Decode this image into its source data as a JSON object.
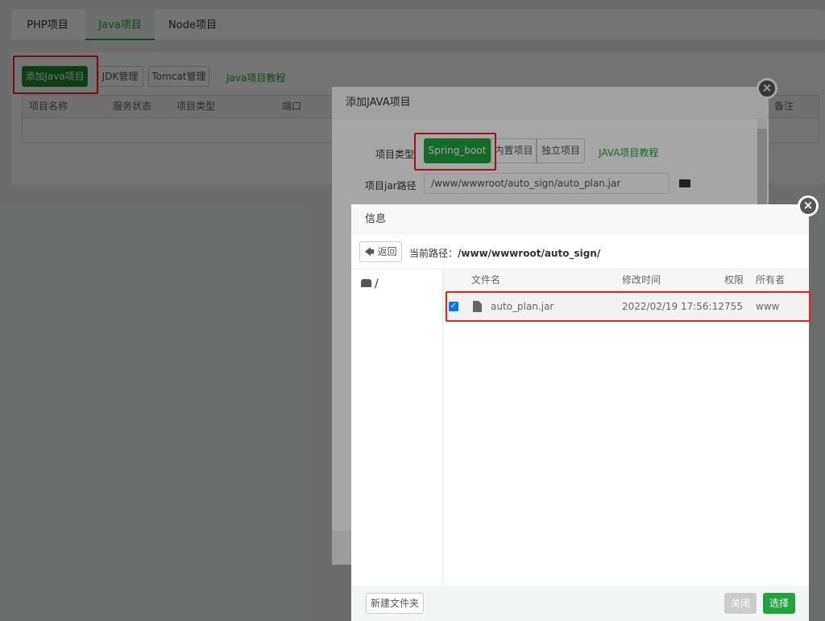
{
  "tabs": [
    {
      "label": "PHP项目"
    },
    {
      "label": "Java项目",
      "active": true
    },
    {
      "label": "Node项目"
    }
  ],
  "toolbar": {
    "add": "添加Java项目",
    "jdk": "JDK管理",
    "tomcat": "Tomcat管理",
    "tutorial": "Java项目教程"
  },
  "table": {
    "headers": [
      "项目名称",
      "服务状态",
      "项目类型",
      "端口",
      "备注"
    ]
  },
  "add_dialog": {
    "title": "添加JAVA项目",
    "type_label": "项目类型",
    "types": [
      "Spring_boot",
      "内置项目",
      "独立项目"
    ],
    "selected_type": "Spring_boot",
    "tutorial": "JAVA项目教程",
    "jar_label": "项目jar路径",
    "jar_value": "/www/wwwroot/auto_sign/auto_plan.jar",
    "folder_icon": "folder-open-icon"
  },
  "file_dialog": {
    "title": "信息",
    "back": "返回",
    "path_label": "当前路径：",
    "path": "/www/wwwroot/auto_sign/",
    "tree_root": "/",
    "headers": [
      "文件名",
      "修改时间",
      "权限",
      "所有者"
    ],
    "files": [
      {
        "name": "auto_plan.jar",
        "modified": "2022/02/19 17:56:12",
        "perm": "755",
        "owner": "www",
        "checked": true
      }
    ],
    "new_folder": "新建文件夹",
    "close": "关闭",
    "select": "选择"
  },
  "colors": {
    "accent": "#20a53a",
    "highlight": "#f02020"
  }
}
